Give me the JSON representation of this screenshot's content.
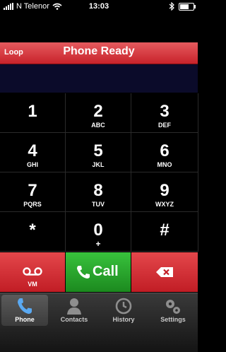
{
  "status_bar": {
    "carrier": "N Telenor",
    "time": "13:03"
  },
  "header": {
    "loop_label": "Loop",
    "title": "Phone Ready"
  },
  "keypad": {
    "keys": [
      {
        "digit": "1",
        "letters": ""
      },
      {
        "digit": "2",
        "letters": "ABC"
      },
      {
        "digit": "3",
        "letters": "DEF"
      },
      {
        "digit": "4",
        "letters": "GHI"
      },
      {
        "digit": "5",
        "letters": "JKL"
      },
      {
        "digit": "6",
        "letters": "MNO"
      },
      {
        "digit": "7",
        "letters": "PQRS"
      },
      {
        "digit": "8",
        "letters": "TUV"
      },
      {
        "digit": "9",
        "letters": "WXYZ"
      },
      {
        "digit": "*",
        "letters": ""
      },
      {
        "digit": "0",
        "letters": "+"
      },
      {
        "digit": "#",
        "letters": ""
      }
    ]
  },
  "actions": {
    "voicemail_label": "VM",
    "call_label": "Call"
  },
  "tabs": [
    {
      "label": "Phone",
      "icon": "phone-icon",
      "active": true
    },
    {
      "label": "Contacts",
      "icon": "contacts-icon",
      "active": false
    },
    {
      "label": "History",
      "icon": "clock-icon",
      "active": false
    },
    {
      "label": "Settings",
      "icon": "gears-icon",
      "active": false
    }
  ],
  "colors": {
    "header_red": "#d33a3f",
    "call_green": "#2aa82e",
    "vm_red": "#d22d33"
  }
}
